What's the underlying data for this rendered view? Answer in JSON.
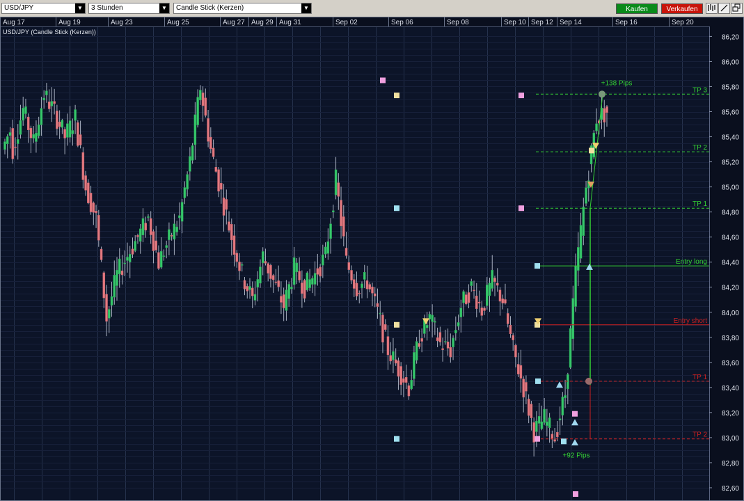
{
  "toolbar": {
    "symbol": "USD/JPY",
    "interval": "3 Stunden",
    "chart_style": "Candle Stick (Kerzen)",
    "buy_label": "Kaufen",
    "sell_label": "Verkaufen",
    "buy_color": "#0a8a1a",
    "sell_color": "#c8140a",
    "icons": [
      "bars-icon",
      "draw-line-icon",
      "detach-window-icon"
    ]
  },
  "chart_data": {
    "type": "candlestick",
    "title": "USD/JPY (Candle Stick (Kerzen))",
    "x_tick_labels": [
      "Aug 17",
      "Aug 19",
      "Aug 23",
      "Aug 25",
      "Aug 27",
      "Aug 29",
      "Aug 31",
      "Sep 02",
      "Sep 06",
      "Sep 08",
      "Sep 10",
      "Sep 12",
      "Sep 14",
      "Sep 16",
      "Sep 20"
    ],
    "y_tick_labels": [
      "86,20",
      "86,00",
      "85,80",
      "85,60",
      "85,40",
      "85,20",
      "85,00",
      "84,80",
      "84,60",
      "84,40",
      "84,20",
      "84,00",
      "83,80",
      "83,60",
      "83,40",
      "83,20",
      "83,00",
      "82,80",
      "82,60"
    ],
    "ylim": [
      82.5,
      86.28
    ],
    "grid": true,
    "colors": {
      "background": "#0c1428",
      "grid": "#25314c",
      "up_candle": "#36c96b",
      "down_candle": "#e37a80",
      "wick": "#a8b0c0",
      "long": "#34d034",
      "short": "#cc2020"
    },
    "candle_trend": [
      [
        85.3,
        85.5
      ],
      [
        85.3,
        85.62
      ],
      [
        85.62,
        85.35
      ],
      [
        85.35,
        85.74
      ],
      [
        85.74,
        85.6
      ],
      [
        85.6,
        85.4
      ],
      [
        85.4,
        85.55
      ],
      [
        85.55,
        85.0
      ],
      [
        85.0,
        84.75
      ],
      [
        84.75,
        83.95
      ],
      [
        83.95,
        84.3
      ],
      [
        84.3,
        84.45
      ],
      [
        84.45,
        84.6
      ],
      [
        84.6,
        84.75
      ],
      [
        84.75,
        84.4
      ],
      [
        84.4,
        84.58
      ],
      [
        84.58,
        84.75
      ],
      [
        84.75,
        85.2
      ],
      [
        85.2,
        85.8
      ],
      [
        85.8,
        85.3
      ],
      [
        85.3,
        84.95
      ],
      [
        84.95,
        84.6
      ],
      [
        84.6,
        84.3
      ],
      [
        84.3,
        84.1
      ],
      [
        84.1,
        84.45
      ],
      [
        84.45,
        84.25
      ],
      [
        84.25,
        84.05
      ],
      [
        84.05,
        84.35
      ],
      [
        84.35,
        84.2
      ],
      [
        84.2,
        84.3
      ],
      [
        84.3,
        84.45
      ],
      [
        84.45,
        85.05
      ],
      [
        85.05,
        84.4
      ],
      [
        84.4,
        84.2
      ],
      [
        84.2,
        84.25
      ],
      [
        84.25,
        84.0
      ],
      [
        84.0,
        83.7
      ],
      [
        83.7,
        83.55
      ],
      [
        83.55,
        83.4
      ],
      [
        83.4,
        83.8
      ],
      [
        83.8,
        83.95
      ],
      [
        83.95,
        83.75
      ],
      [
        83.75,
        83.7
      ],
      [
        83.7,
        84.05
      ],
      [
        84.05,
        84.2
      ],
      [
        84.2,
        84.02
      ],
      [
        84.02,
        84.25
      ],
      [
        84.25,
        84.1
      ],
      [
        84.1,
        83.7
      ],
      [
        83.7,
        83.4
      ],
      [
        83.4,
        83.05
      ],
      [
        83.05,
        83.15
      ],
      [
        83.15,
        83.0
      ],
      [
        83.0,
        83.35
      ],
      [
        83.35,
        84.3
      ],
      [
        84.3,
        85.0
      ],
      [
        85.0,
        85.55
      ],
      [
        85.55,
        85.6
      ]
    ],
    "annotations": {
      "price_labels": [
        {
          "text": "+138 Pips",
          "color": "#34d034"
        },
        {
          "text": "+92 Pips",
          "color": "#34d034"
        }
      ],
      "levels": [
        {
          "label": "TP 3",
          "price": 85.74,
          "color": "#34d034",
          "style": "dashed"
        },
        {
          "label": "TP 2",
          "price": 85.28,
          "color": "#34d034",
          "style": "dashed"
        },
        {
          "label": "TP 1",
          "price": 84.83,
          "color": "#34d034",
          "style": "dashed"
        },
        {
          "label": "Entry long",
          "price": 84.37,
          "color": "#34d034",
          "style": "solid"
        },
        {
          "label": "Entry short",
          "price": 83.9,
          "color": "#cc2020",
          "style": "solid"
        },
        {
          "label": "TP 1",
          "price": 83.45,
          "color": "#cc2020",
          "style": "dashed"
        },
        {
          "label": "TP 2",
          "price": 82.99,
          "color": "#cc2020",
          "style": "dashed"
        }
      ]
    }
  }
}
